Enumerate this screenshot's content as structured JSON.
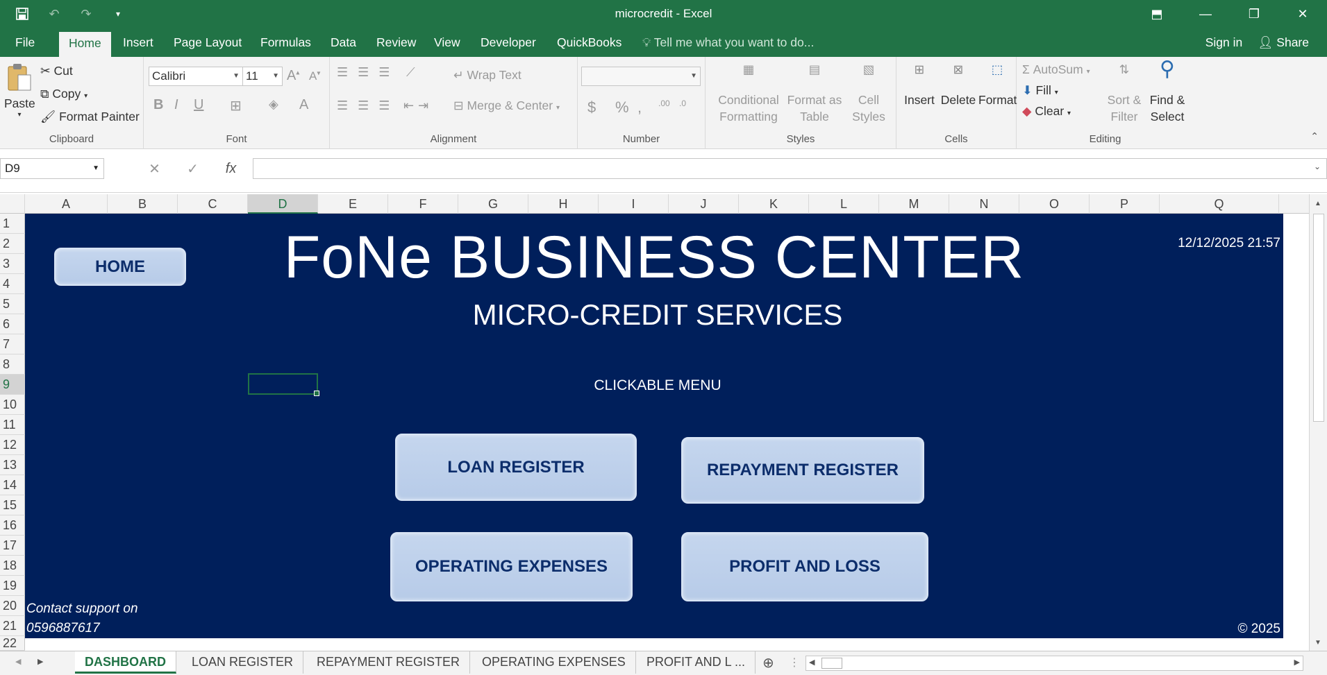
{
  "window": {
    "title": "microcredit - Excel"
  },
  "menu": {
    "tabs": [
      "File",
      "Home",
      "Insert",
      "Page Layout",
      "Formulas",
      "Data",
      "Review",
      "View",
      "Developer",
      "QuickBooks"
    ],
    "tell_me": "Tell me what you want to do...",
    "sign_in": "Sign in",
    "share": "Share"
  },
  "ribbon": {
    "clipboard": {
      "paste": "Paste",
      "cut": "Cut",
      "copy": "Copy",
      "format_painter": "Format Painter",
      "label": "Clipboard"
    },
    "font": {
      "name": "Calibri",
      "size": "11",
      "label": "Font"
    },
    "alignment": {
      "wrap_text": "Wrap Text",
      "merge_center": "Merge & Center",
      "label": "Alignment"
    },
    "number": {
      "label": "Number"
    },
    "styles": {
      "conditional": "Conditional",
      "formatting": "Formatting",
      "format_as": "Format as",
      "table": "Table",
      "cell": "Cell",
      "styles": "Styles",
      "label": "Styles"
    },
    "cells": {
      "insert": "Insert",
      "delete": "Delete",
      "format": "Format",
      "label": "Cells"
    },
    "editing": {
      "autosum": "AutoSum",
      "fill": "Fill",
      "clear": "Clear",
      "sort": "Sort &",
      "filter": "Filter",
      "find": "Find &",
      "select": "Select",
      "label": "Editing"
    }
  },
  "formula_bar": {
    "name_box": "D9",
    "formula": ""
  },
  "grid": {
    "columns": [
      "A",
      "B",
      "C",
      "D",
      "E",
      "F",
      "G",
      "H",
      "I",
      "J",
      "K",
      "L",
      "M",
      "N",
      "O",
      "P",
      "Q"
    ],
    "rows": [
      "1",
      "2",
      "3",
      "4",
      "5",
      "6",
      "7",
      "8",
      "9",
      "10",
      "11",
      "12",
      "13",
      "14",
      "15",
      "16",
      "17",
      "18",
      "19",
      "20",
      "21",
      "22"
    ],
    "selected_column": "D",
    "selected_row": "9"
  },
  "dashboard": {
    "title": "FoNe BUSINESS CENTER",
    "subtitle": "MICRO-CREDIT SERVICES",
    "menu_label": "CLICKABLE MENU",
    "datetime": "12/12/2025 21:57",
    "home_button": "HOME",
    "loan_register_button": "LOAN REGISTER",
    "repayment_register_button": "REPAYMENT REGISTER",
    "operating_expenses_button": "OPERATING EXPENSES",
    "profit_loss_button": "PROFIT AND LOSS",
    "support_line1": "Contact support on",
    "support_line2": "0596887617",
    "copyright": "© 2025"
  },
  "sheet_tabs": [
    "DASHBOARD",
    "LOAN REGISTER",
    "REPAYMENT REGISTER",
    "OPERATING EXPENSES",
    "PROFIT AND L ..."
  ],
  "colors": {
    "excel_green": "#217346",
    "dashboard_bg": "#001f5b",
    "button_fill": "#b7cbe8",
    "button_text": "#0c2d6b"
  }
}
